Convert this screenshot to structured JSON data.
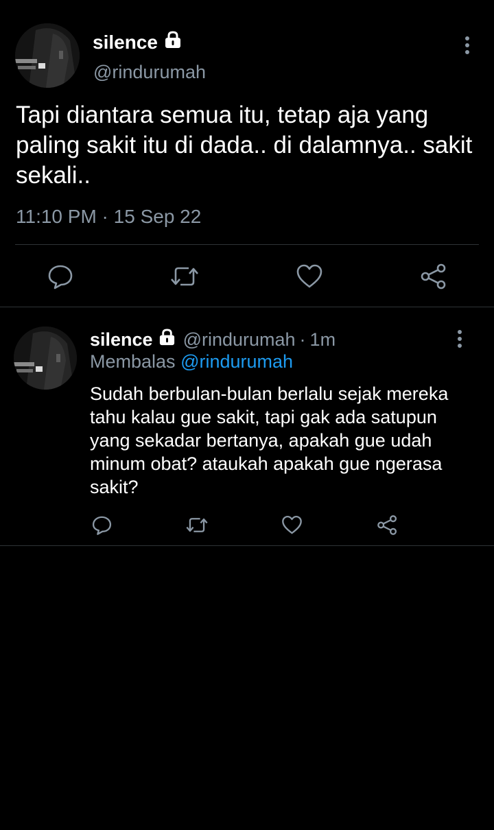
{
  "main_tweet": {
    "display_name": "silence",
    "handle": "@rindurumah",
    "text": "Tapi diantara semua itu, tetap aja yang paling sakit itu di dada.. di dalamnya.. sakit sekali..",
    "timestamp": "11:10 PM · 15 Sep 22"
  },
  "reply_tweet": {
    "display_name": "silence",
    "handle": "@rindurumah",
    "separator": "·",
    "time": "1m",
    "replying_label": "Membalas",
    "replying_mention": "@rindurumah",
    "text": "Sudah berbulan-bulan berlalu  sejak mereka tahu kalau gue sakit, tapi gak ada satupun yang sekadar bertanya, apakah gue udah minum obat? ataukah apakah gue ngerasa sakit?"
  },
  "icons": {
    "lock": "lock-icon",
    "more": "more-vertical-icon",
    "reply": "comment-icon",
    "retweet": "retweet-icon",
    "like": "heart-icon",
    "share": "share-icon"
  },
  "colors": {
    "background": "#000000",
    "text_primary": "#ffffff",
    "text_secondary": "#8b98a5",
    "accent": "#1d9bf0",
    "divider": "#2f3336"
  }
}
